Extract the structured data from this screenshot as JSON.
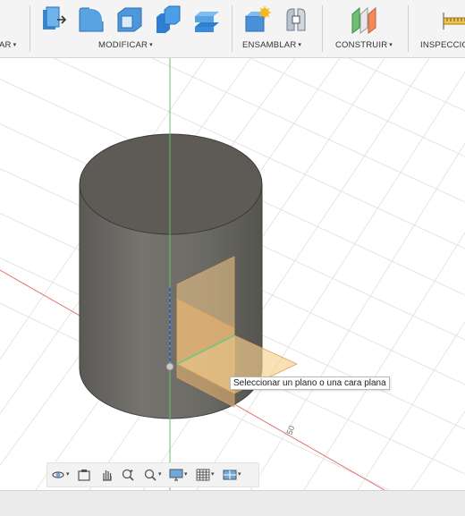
{
  "toolbar": {
    "groups": {
      "create_partial": "AR",
      "modify": "MODIFICAR",
      "assemble": "ENSAMBLAR",
      "construct": "CONSTRUIR",
      "inspect_partial": "INSPECCIO"
    },
    "dropdown_caret": "▾",
    "icons": [
      "press-pull-icon",
      "fillet-icon",
      "shell-icon",
      "combine-icon",
      "split-body-icon",
      "new-component-icon",
      "joint-icon",
      "offset-plane-icon",
      "measure-icon"
    ]
  },
  "viewport": {
    "tooltip": "Seleccionar un plano o una cara plana",
    "axis_tick_label": "50"
  },
  "navbar": {
    "tools": [
      "orbit-icon",
      "look-at-icon",
      "pan-icon",
      "zoom-icon",
      "zoom-window-icon",
      "display-settings-icon",
      "grid-settings-icon",
      "viewports-icon"
    ]
  },
  "colors": {
    "toolbar_bg": "#f4f4f4",
    "cylinder_body": "#6b6b66",
    "cylinder_top": "#5d5a55",
    "plane_fill": "#f3c98b",
    "x_axis": "#e07070",
    "y_axis": "#70c070"
  }
}
